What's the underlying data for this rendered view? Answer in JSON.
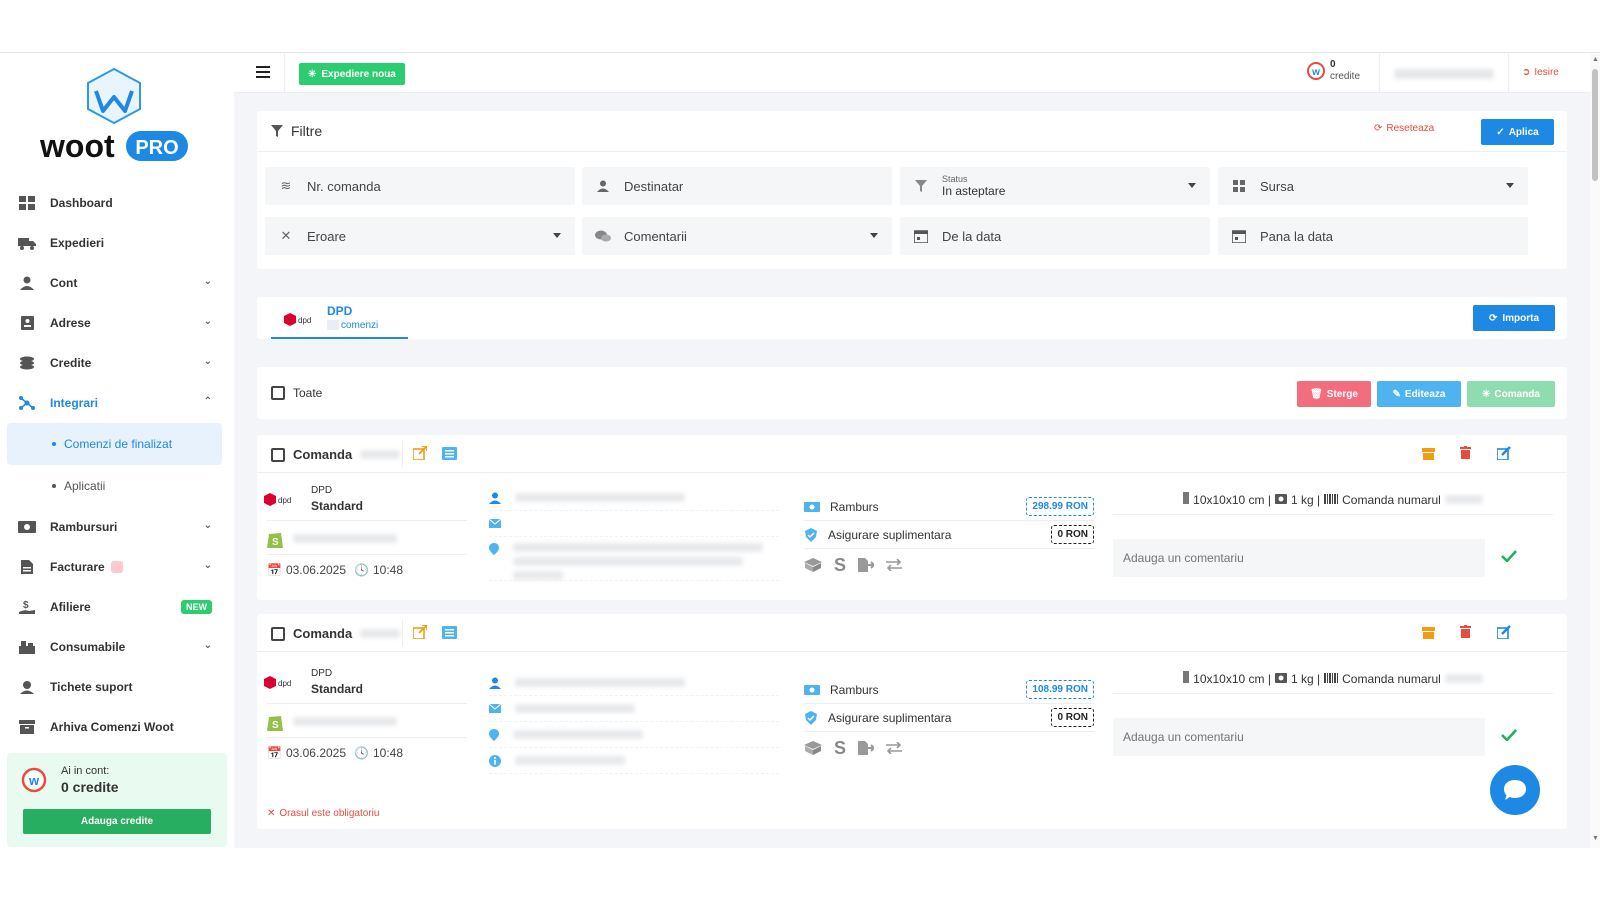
{
  "brand": {
    "name": "woot",
    "badge": "PRO",
    "color": "#1e88e5"
  },
  "sidebar": {
    "items": [
      {
        "label": "Dashboard",
        "icon": "dashboard-icon"
      },
      {
        "label": "Expedieri",
        "icon": "truck-icon"
      },
      {
        "label": "Cont",
        "icon": "user-icon"
      },
      {
        "label": "Adrese",
        "icon": "address-book-icon"
      },
      {
        "label": "Credite",
        "icon": "coins-icon"
      },
      {
        "label": "Integrari",
        "icon": "network-icon"
      },
      {
        "label": "Rambursuri",
        "icon": "money-icon"
      },
      {
        "label": "Facturare",
        "icon": "invoice-icon"
      },
      {
        "label": "Afiliere",
        "icon": "hand-dollar-icon",
        "badge": "NEW"
      },
      {
        "label": "Consumabile",
        "icon": "boxes-icon"
      },
      {
        "label": "Tichete suport",
        "icon": "support-icon"
      },
      {
        "label": "Arhiva Comenzi Woot",
        "icon": "archive-icon"
      }
    ],
    "subitems": [
      {
        "label": "Comenzi de finalizat"
      },
      {
        "label": "Aplicatii"
      }
    ],
    "credits_box": {
      "line1": "Ai in cont:",
      "line2": "0 credite",
      "button": "Adauga credite"
    }
  },
  "topbar": {
    "new_button": "Expediere noua",
    "credits_num": "0",
    "credits_label": "credite",
    "exit": "Iesire"
  },
  "filters": {
    "title": "Filtre",
    "reset": "Reseteaza",
    "apply": "Aplica",
    "order_no": "Nr. comanda",
    "recipient": "Destinatar",
    "status_label": "Status",
    "status_value": "In asteptare",
    "source": "Sursa",
    "error": "Eroare",
    "comments": "Comentarii",
    "from_date": "De la data",
    "to_date": "Pana la data"
  },
  "tab": {
    "name": "DPD",
    "sub": "comenzi",
    "import": "Importa"
  },
  "bulk": {
    "all": "Toate",
    "delete": "Sterge",
    "edit": "Editeaza",
    "order": "Comanda"
  },
  "orders": [
    {
      "label": "Comanda",
      "courier": "DPD",
      "service": "Standard",
      "date": "03.06.2025",
      "time": "10:48",
      "cod_label": "Ramburs",
      "cod_value": "298.99 RON",
      "insurance_label": "Asigurare suplimentara",
      "insurance_value": "0 RON",
      "dims": "10x10x10 cm |",
      "weight": "1 kg |",
      "order_no_label": "Comanda numarul",
      "comment_placeholder": "Adauga un comentariu"
    },
    {
      "label": "Comanda",
      "courier": "DPD",
      "service": "Standard",
      "date": "03.06.2025",
      "time": "10:48",
      "cod_label": "Ramburs",
      "cod_value": "108.99 RON",
      "insurance_label": "Asigurare suplimentara",
      "insurance_value": "0 RON",
      "dims": "10x10x10 cm |",
      "weight": "1 kg |",
      "order_no_label": "Comanda numarul",
      "comment_placeholder": "Adauga un comentariu",
      "error": "Orasul este obligatoriu"
    }
  ],
  "colors": {
    "green": "#2ecc71",
    "blue": "#1e88e5",
    "red": "#e74c3c",
    "pink": "#f26d7d",
    "lightblue": "#4fb3f0",
    "lightgreen": "#8fdcb1",
    "orange": "#f39c12"
  }
}
